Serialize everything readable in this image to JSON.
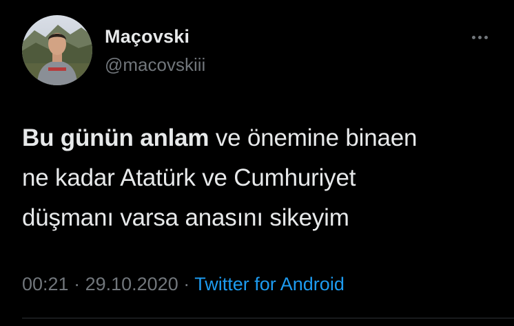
{
  "author": {
    "display_name": "Maçovski",
    "handle": "@macovskiii",
    "avatar": "profile-photo"
  },
  "more_icon": "more-horizontal-icon",
  "tweet": {
    "bold_text": "Bu günün anlam",
    "line1_rest": " ve önemine binaen",
    "line2": "ne kadar Atatürk ve Cumhuriyet",
    "line3": "düşmanı varsa anasını sikeyim"
  },
  "meta": {
    "time": "00:21",
    "separator": " · ",
    "date": "29.10.2020",
    "source": "Twitter for Android"
  },
  "colors": {
    "background": "#000000",
    "text_primary": "#e7e9ea",
    "text_secondary": "#71767b",
    "link": "#1d9bf0",
    "divider": "#2f3336"
  }
}
